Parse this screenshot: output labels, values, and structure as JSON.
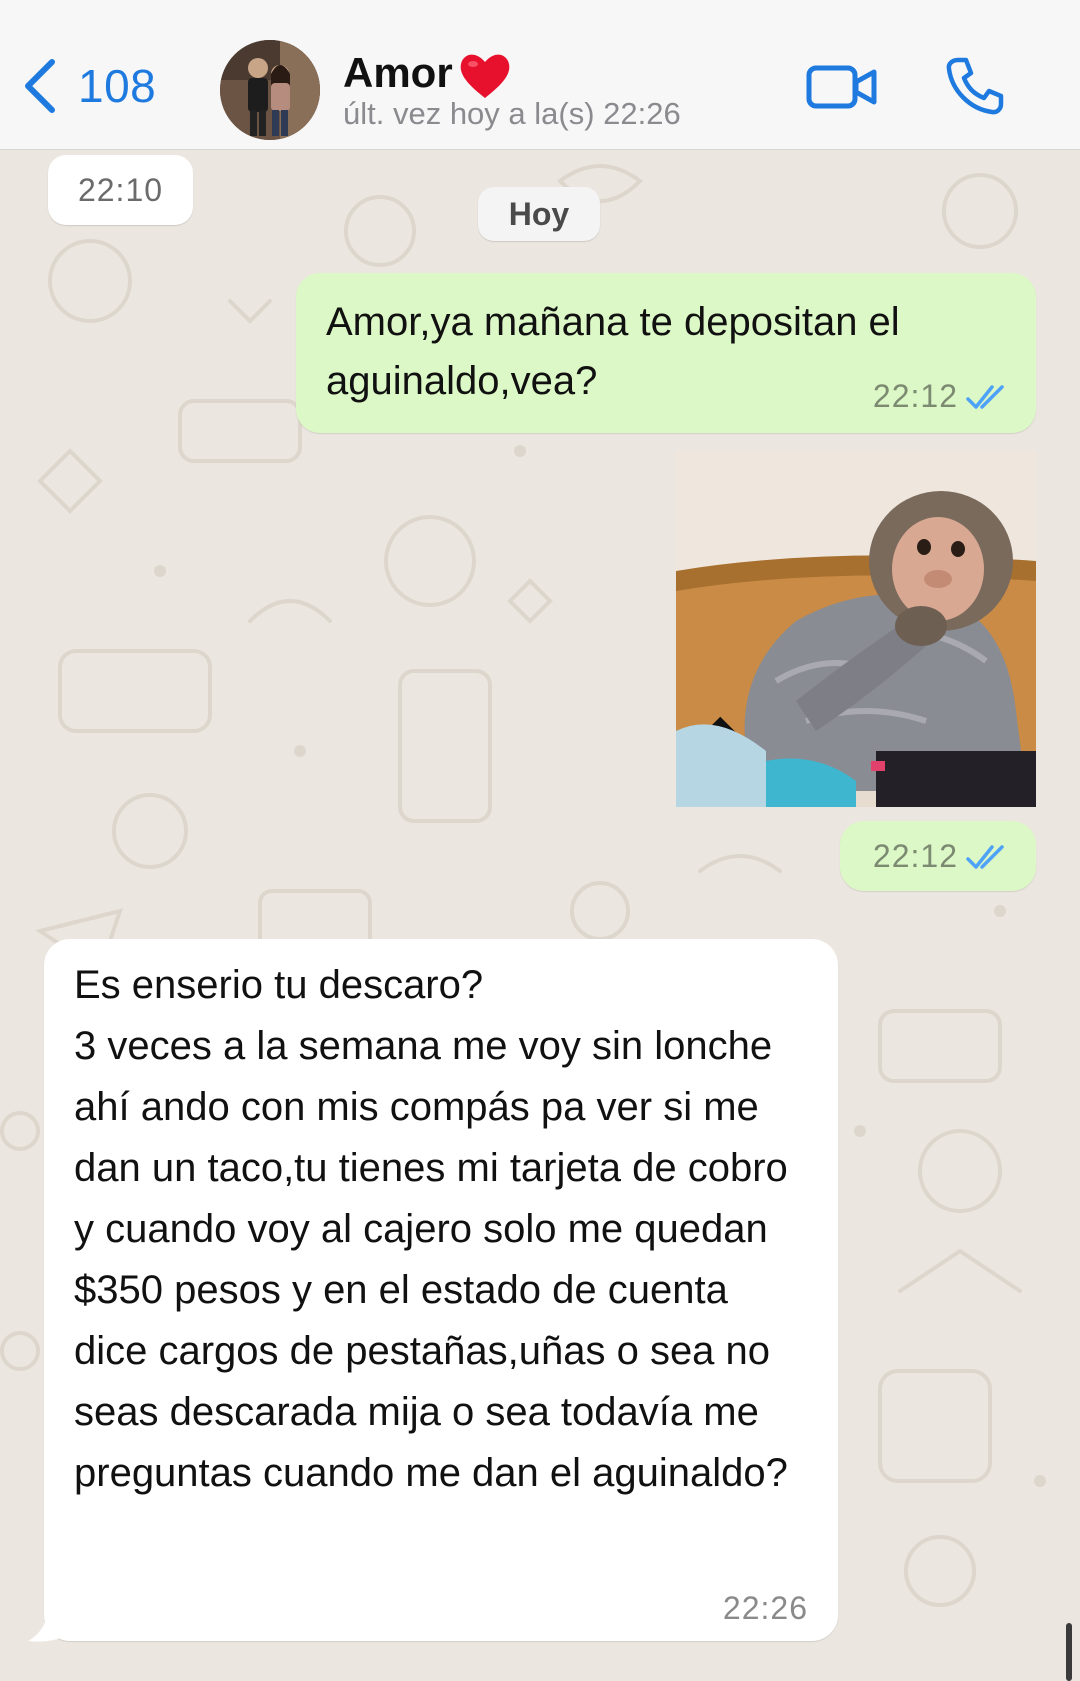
{
  "header": {
    "back_count": "108",
    "contact_name": "Amor",
    "last_seen": "últ. vez hoy a la(s) 22:26",
    "icons": {
      "back": "chevron-left-icon",
      "video": "video-camera-icon",
      "call": "phone-icon",
      "name_emoji": "red-heart-icon"
    },
    "accent_color": "#1f7ae0"
  },
  "chat": {
    "time_chip": "22:10",
    "date_chip": "Hoy",
    "messages": [
      {
        "direction": "outgoing",
        "type": "text",
        "text": "Amor,ya mañana te depositan el aguinaldo,vea?",
        "time": "22:12",
        "status": "read"
      },
      {
        "direction": "outgoing",
        "type": "image",
        "image": "monkey-photo",
        "time": "22:12",
        "status": "read"
      },
      {
        "direction": "incoming",
        "type": "text",
        "text": "Es enserio tu descaro?\n3 veces a la semana me voy sin lonche ahí ando con mis compás pa ver si me dan un taco,tu tienes mi tarjeta de cobro y cuando voy al cajero solo me quedan $350 pesos y en el estado de cuenta dice cargos de pestañas,uñas o sea  no seas descarada mija o sea todavía me preguntas cuando me dan el aguinaldo?",
        "time": "22:26"
      }
    ],
    "colors": {
      "outgoing_bubble": "#dcf8c6",
      "incoming_bubble": "#ffffff",
      "read_ticks": "#4fa3f7",
      "wallpaper": "#ebe6df"
    }
  }
}
